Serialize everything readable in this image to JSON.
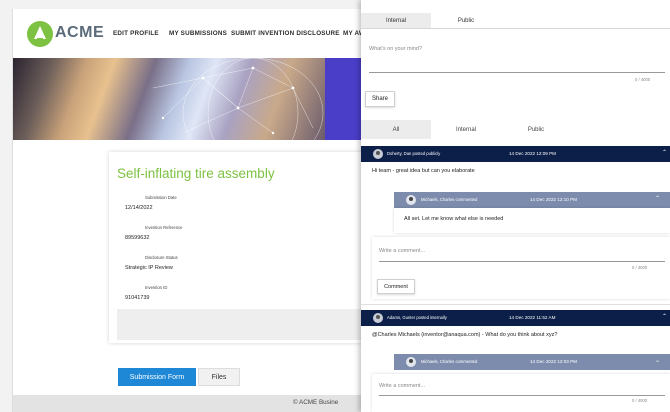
{
  "app": {
    "logo_text": "ACME",
    "nav": [
      "EDIT PROFILE",
      "MY SUBMISSIONS",
      "SUBMIT INVENTION DISCLOSURE",
      "MY AW"
    ],
    "submission": {
      "title": "Self-inflating tire assembly",
      "fields": [
        {
          "label": "Submission Date",
          "value": "12/14/2022"
        },
        {
          "label": "Invention Reference",
          "value": "89599632"
        },
        {
          "label": "Disclosure Status",
          "value": "Strategic IP Review"
        },
        {
          "label": "Invention ID",
          "value": "91041739"
        }
      ]
    },
    "bottom_tabs": {
      "active": "Submission Form",
      "inactive": "Files"
    },
    "footer": "© ACME Busine",
    "colors": {
      "brand_green": "#7dc242",
      "tab_blue": "#1e88d6",
      "hero_purple": "#4a3ec9"
    }
  },
  "panel": {
    "tabs": [
      "Internal",
      "Public"
    ],
    "composer": {
      "placeholder": "What's on your mind?",
      "count": "0 / 4000",
      "share_label": "Share"
    },
    "filters": [
      "All",
      "Internal",
      "Public"
    ],
    "threads": [
      {
        "author": "Doherty, Dan posted publicly",
        "date": "14 Dec 2022 12:09 PM",
        "body": "Hi team - great idea but can you elaborate",
        "reply": {
          "author": "Michaels, Charles commented",
          "date": "14 Dec 2022 12:10 PM",
          "body": "All set. Let me know what else is needed"
        },
        "comment": {
          "placeholder": "Write a comment...",
          "count": "0 / 4000",
          "button": "Comment"
        }
      },
      {
        "author": "Adams, Gunter posted internally",
        "date": "14 Dec 2022 11:52 AM",
        "body": "@Charles Michaels (inventor@anaqua.com) - What do you think about xyz?",
        "reply": {
          "author": "Michaels, Charles commented",
          "date": "14 Dec 2022 12:03 PM"
        },
        "comment": {
          "placeholder": "Write a comment...",
          "count": "0 / 4000"
        }
      }
    ],
    "colors": {
      "thread_header": "#0c1f49",
      "reply_header": "#7d8cad"
    }
  }
}
